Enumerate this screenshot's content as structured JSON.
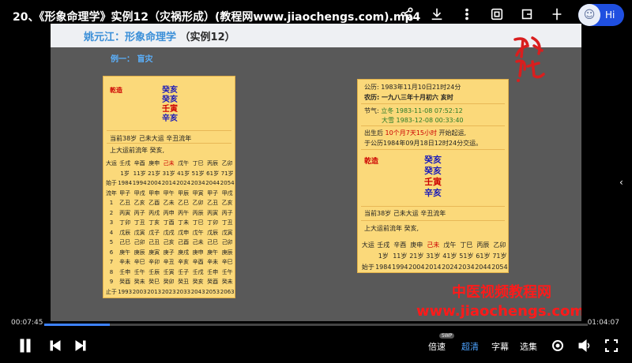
{
  "header": {
    "title": "20、《形象命理学》实例12（灾祸形成）(教程网www.jiaochengs.com).mp4",
    "assistant_label": "Hi"
  },
  "slide": {
    "author": "姚元江：形象命理学",
    "case": "（实例12）",
    "example": "例一：  盲灾"
  },
  "left_card": {
    "label": "乾造",
    "pillars": [
      "癸亥",
      "癸亥",
      "壬寅",
      "辛亥"
    ],
    "age_line": "当前38岁    己未大运    辛丑流年",
    "prev_line": "上大运前流年 癸亥,",
    "rows": [
      [
        "大运",
        "壬戌",
        "辛酉",
        "庚申",
        "己未",
        "戊午",
        "丁巳",
        "丙辰",
        "乙卯"
      ],
      [
        "",
        "1岁",
        "11岁",
        "21岁",
        "31岁",
        "41岁",
        "51岁",
        "61岁",
        "71岁"
      ],
      [
        "始于",
        "1984",
        "1994",
        "2004",
        "2014",
        "2024",
        "2034",
        "2044",
        "2054"
      ],
      [
        "流年",
        "甲子",
        "甲戌",
        "甲申",
        "甲午",
        "甲辰",
        "甲寅",
        "甲子",
        "甲戌"
      ],
      [
        "1",
        "乙丑",
        "乙亥",
        "乙酉",
        "乙未",
        "乙巳",
        "乙卯",
        "乙丑",
        "乙亥"
      ],
      [
        "2",
        "丙寅",
        "丙子",
        "丙戌",
        "丙申",
        "丙午",
        "丙辰",
        "丙寅",
        "丙子"
      ],
      [
        "3",
        "丁卯",
        "丁丑",
        "丁亥",
        "丁酉",
        "丁未",
        "丁巳",
        "丁卯",
        "丁丑"
      ],
      [
        "4",
        "戊辰",
        "戊寅",
        "戊子",
        "戊戌",
        "戊申",
        "戊午",
        "戊辰",
        "戊寅"
      ],
      [
        "5",
        "己巳",
        "己卯",
        "己丑",
        "己亥",
        "己酉",
        "己未",
        "己巳",
        "己卯"
      ],
      [
        "6",
        "庚午",
        "庚辰",
        "庚寅",
        "庚子",
        "庚戌",
        "庚申",
        "庚午",
        "庚辰"
      ],
      [
        "7",
        "辛未",
        "辛巳",
        "辛卯",
        "辛丑",
        "辛亥",
        "辛酉",
        "辛未",
        "辛巳"
      ],
      [
        "8",
        "壬申",
        "壬午",
        "壬辰",
        "壬寅",
        "壬子",
        "壬戌",
        "壬申",
        "壬午"
      ],
      [
        "9",
        "癸酉",
        "癸未",
        "癸巳",
        "癸卯",
        "癸丑",
        "癸亥",
        "癸酉",
        "癸未"
      ],
      [
        "止于",
        "1993",
        "2003",
        "2013",
        "2023",
        "2033",
        "2043",
        "2053",
        "2063"
      ]
    ]
  },
  "right_card": {
    "gregorian": "公历: 1983年11月10日21时24分",
    "lunar": "农历: 一九八三年十月初六 亥时",
    "jieqi_label": "节气:",
    "lidong": "立冬 1983-11-08 07:52:12",
    "daxue": "大雪 1983-12-08 00:33:40",
    "start_pre": "出生后 ",
    "start_hl": "10个月7天15小时",
    "start_post": " 开始起运,",
    "handover": "于公历1984年09月18日12时24分交运。",
    "label": "乾造",
    "pillars": [
      "癸亥",
      "癸亥",
      "壬寅",
      "辛亥"
    ],
    "age_line": "当前38岁    己未大运    辛丑流年",
    "prev_line": "上大运前流年 癸亥,",
    "rows": [
      [
        "大运",
        "壬戌",
        "辛酉",
        "庚申",
        "己未",
        "戊午",
        "丁巳",
        "丙辰",
        "乙卯"
      ],
      [
        "",
        "1岁",
        "11岁",
        "21岁",
        "31岁",
        "41岁",
        "51岁",
        "61岁",
        "71岁"
      ],
      [
        "始于",
        "1984",
        "1994",
        "2004",
        "2014",
        "2024",
        "2034",
        "2044",
        "2054"
      ]
    ]
  },
  "watermark": {
    "logo": "神机阁",
    "cn": "中医视频教程网",
    "url": "www.jiaochengs.com"
  },
  "player": {
    "current_time": "00:07:45",
    "total_time": "01:04:07",
    "progress": 0.121,
    "speed_label": "倍速",
    "speed_badge": "SWP",
    "quality_label": "超清",
    "subtitle_label": "字幕",
    "episodes_label": "选集"
  },
  "colors": {
    "accent": "#3e82ff",
    "card": "#fbd97a",
    "watermark": "#ff1a1a"
  }
}
